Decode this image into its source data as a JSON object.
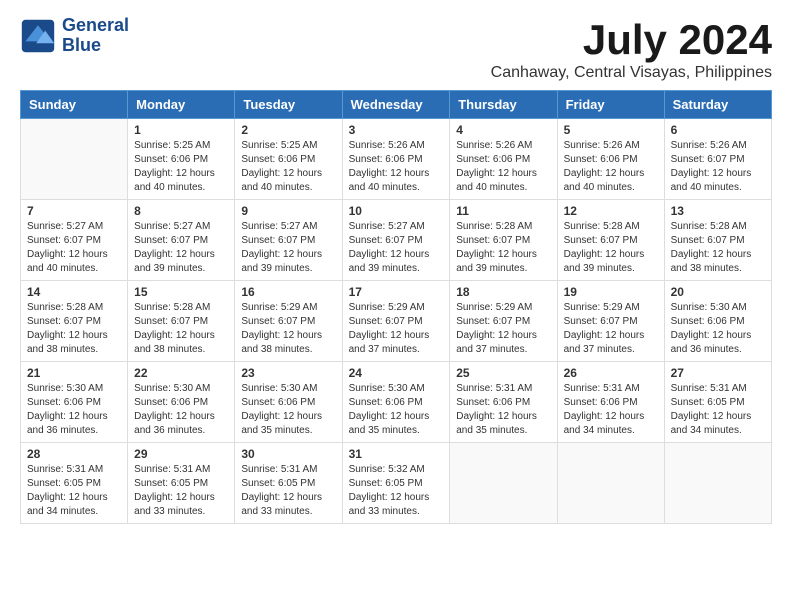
{
  "logo": {
    "line1": "General",
    "line2": "Blue"
  },
  "title": "July 2024",
  "subtitle": "Canhaway, Central Visayas, Philippines",
  "days_of_week": [
    "Sunday",
    "Monday",
    "Tuesday",
    "Wednesday",
    "Thursday",
    "Friday",
    "Saturday"
  ],
  "weeks": [
    [
      {
        "day": "",
        "empty": true
      },
      {
        "day": "1",
        "sunrise": "5:25 AM",
        "sunset": "6:06 PM",
        "daylight": "12 hours and 40 minutes."
      },
      {
        "day": "2",
        "sunrise": "5:25 AM",
        "sunset": "6:06 PM",
        "daylight": "12 hours and 40 minutes."
      },
      {
        "day": "3",
        "sunrise": "5:26 AM",
        "sunset": "6:06 PM",
        "daylight": "12 hours and 40 minutes."
      },
      {
        "day": "4",
        "sunrise": "5:26 AM",
        "sunset": "6:06 PM",
        "daylight": "12 hours and 40 minutes."
      },
      {
        "day": "5",
        "sunrise": "5:26 AM",
        "sunset": "6:06 PM",
        "daylight": "12 hours and 40 minutes."
      },
      {
        "day": "6",
        "sunrise": "5:26 AM",
        "sunset": "6:07 PM",
        "daylight": "12 hours and 40 minutes."
      }
    ],
    [
      {
        "day": "7",
        "sunrise": "5:27 AM",
        "sunset": "6:07 PM",
        "daylight": "12 hours and 40 minutes."
      },
      {
        "day": "8",
        "sunrise": "5:27 AM",
        "sunset": "6:07 PM",
        "daylight": "12 hours and 39 minutes."
      },
      {
        "day": "9",
        "sunrise": "5:27 AM",
        "sunset": "6:07 PM",
        "daylight": "12 hours and 39 minutes."
      },
      {
        "day": "10",
        "sunrise": "5:27 AM",
        "sunset": "6:07 PM",
        "daylight": "12 hours and 39 minutes."
      },
      {
        "day": "11",
        "sunrise": "5:28 AM",
        "sunset": "6:07 PM",
        "daylight": "12 hours and 39 minutes."
      },
      {
        "day": "12",
        "sunrise": "5:28 AM",
        "sunset": "6:07 PM",
        "daylight": "12 hours and 39 minutes."
      },
      {
        "day": "13",
        "sunrise": "5:28 AM",
        "sunset": "6:07 PM",
        "daylight": "12 hours and 38 minutes."
      }
    ],
    [
      {
        "day": "14",
        "sunrise": "5:28 AM",
        "sunset": "6:07 PM",
        "daylight": "12 hours and 38 minutes."
      },
      {
        "day": "15",
        "sunrise": "5:28 AM",
        "sunset": "6:07 PM",
        "daylight": "12 hours and 38 minutes."
      },
      {
        "day": "16",
        "sunrise": "5:29 AM",
        "sunset": "6:07 PM",
        "daylight": "12 hours and 38 minutes."
      },
      {
        "day": "17",
        "sunrise": "5:29 AM",
        "sunset": "6:07 PM",
        "daylight": "12 hours and 37 minutes."
      },
      {
        "day": "18",
        "sunrise": "5:29 AM",
        "sunset": "6:07 PM",
        "daylight": "12 hours and 37 minutes."
      },
      {
        "day": "19",
        "sunrise": "5:29 AM",
        "sunset": "6:07 PM",
        "daylight": "12 hours and 37 minutes."
      },
      {
        "day": "20",
        "sunrise": "5:30 AM",
        "sunset": "6:06 PM",
        "daylight": "12 hours and 36 minutes."
      }
    ],
    [
      {
        "day": "21",
        "sunrise": "5:30 AM",
        "sunset": "6:06 PM",
        "daylight": "12 hours and 36 minutes."
      },
      {
        "day": "22",
        "sunrise": "5:30 AM",
        "sunset": "6:06 PM",
        "daylight": "12 hours and 36 minutes."
      },
      {
        "day": "23",
        "sunrise": "5:30 AM",
        "sunset": "6:06 PM",
        "daylight": "12 hours and 35 minutes."
      },
      {
        "day": "24",
        "sunrise": "5:30 AM",
        "sunset": "6:06 PM",
        "daylight": "12 hours and 35 minutes."
      },
      {
        "day": "25",
        "sunrise": "5:31 AM",
        "sunset": "6:06 PM",
        "daylight": "12 hours and 35 minutes."
      },
      {
        "day": "26",
        "sunrise": "5:31 AM",
        "sunset": "6:06 PM",
        "daylight": "12 hours and 34 minutes."
      },
      {
        "day": "27",
        "sunrise": "5:31 AM",
        "sunset": "6:05 PM",
        "daylight": "12 hours and 34 minutes."
      }
    ],
    [
      {
        "day": "28",
        "sunrise": "5:31 AM",
        "sunset": "6:05 PM",
        "daylight": "12 hours and 34 minutes."
      },
      {
        "day": "29",
        "sunrise": "5:31 AM",
        "sunset": "6:05 PM",
        "daylight": "12 hours and 33 minutes."
      },
      {
        "day": "30",
        "sunrise": "5:31 AM",
        "sunset": "6:05 PM",
        "daylight": "12 hours and 33 minutes."
      },
      {
        "day": "31",
        "sunrise": "5:32 AM",
        "sunset": "6:05 PM",
        "daylight": "12 hours and 33 minutes."
      },
      {
        "day": "",
        "empty": true
      },
      {
        "day": "",
        "empty": true
      },
      {
        "day": "",
        "empty": true
      }
    ]
  ]
}
